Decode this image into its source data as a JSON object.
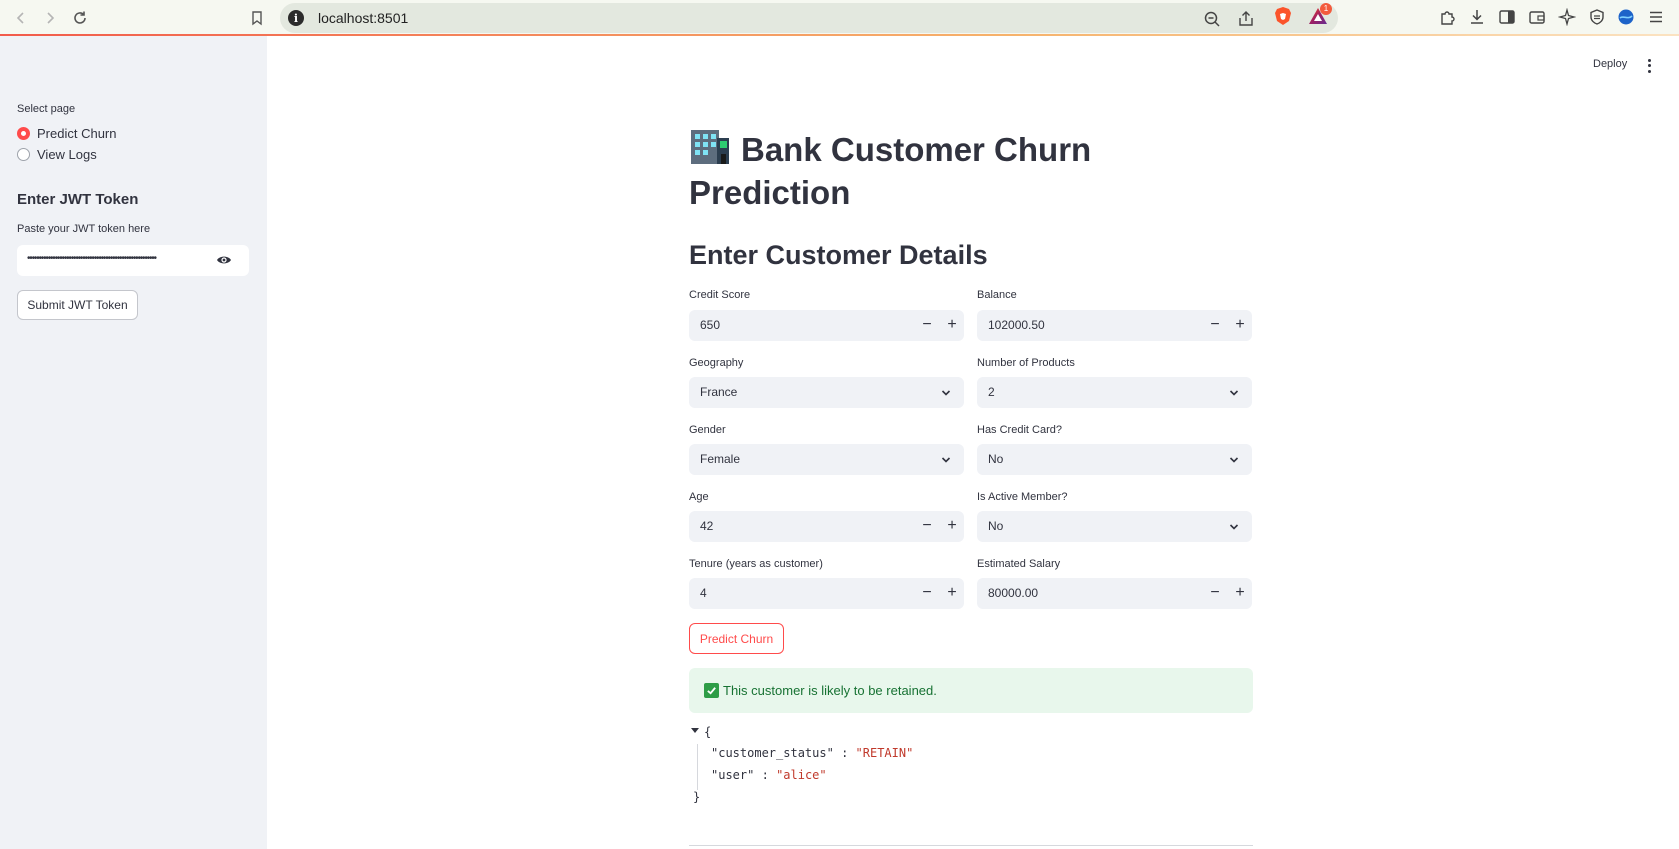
{
  "browser": {
    "url": "localhost:8501",
    "rewards_badge": "1"
  },
  "sidebar": {
    "select_page_label": "Select page",
    "pages": [
      {
        "label": "Predict Churn",
        "selected": true
      },
      {
        "label": "View Logs",
        "selected": false
      }
    ],
    "jwt_heading": "Enter JWT Token",
    "jwt_input_label": "Paste your JWT token here",
    "jwt_masked_value": "••••••••••••••••••••••••••••••••••••••••••••••••••••••••",
    "submit_button": "Submit JWT Token"
  },
  "header": {
    "deploy": "Deploy"
  },
  "main": {
    "title": "Bank Customer Churn Prediction",
    "subtitle": "Enter Customer Details",
    "fields": {
      "credit_score": {
        "label": "Credit Score",
        "value": "650"
      },
      "balance": {
        "label": "Balance",
        "value": "102000.50"
      },
      "geography": {
        "label": "Geography",
        "value": "France"
      },
      "num_products": {
        "label": "Number of Products",
        "value": "2"
      },
      "gender": {
        "label": "Gender",
        "value": "Female"
      },
      "has_credit_card": {
        "label": "Has Credit Card?",
        "value": "No"
      },
      "age": {
        "label": "Age",
        "value": "42"
      },
      "is_active": {
        "label": "Is Active Member?",
        "value": "No"
      },
      "tenure": {
        "label": "Tenure (years as customer)",
        "value": "4"
      },
      "salary": {
        "label": "Estimated Salary",
        "value": "80000.00"
      }
    },
    "stepper_minus": "−",
    "stepper_plus": "+",
    "predict_button": "Predict Churn",
    "result_message": "This customer is likely to be retained.",
    "json_output": {
      "open": "{",
      "close": "}",
      "k1": "\"customer_status\"",
      "v1": "\"RETAIN\"",
      "k2": "\"user\"",
      "v2": "\"alice\"",
      "sep": ":"
    }
  },
  "colors": {
    "accent": "#ff4b4b",
    "sidebar_bg": "#f0f2f6",
    "success_bg": "#e8f7ec",
    "success_text": "#177233"
  }
}
